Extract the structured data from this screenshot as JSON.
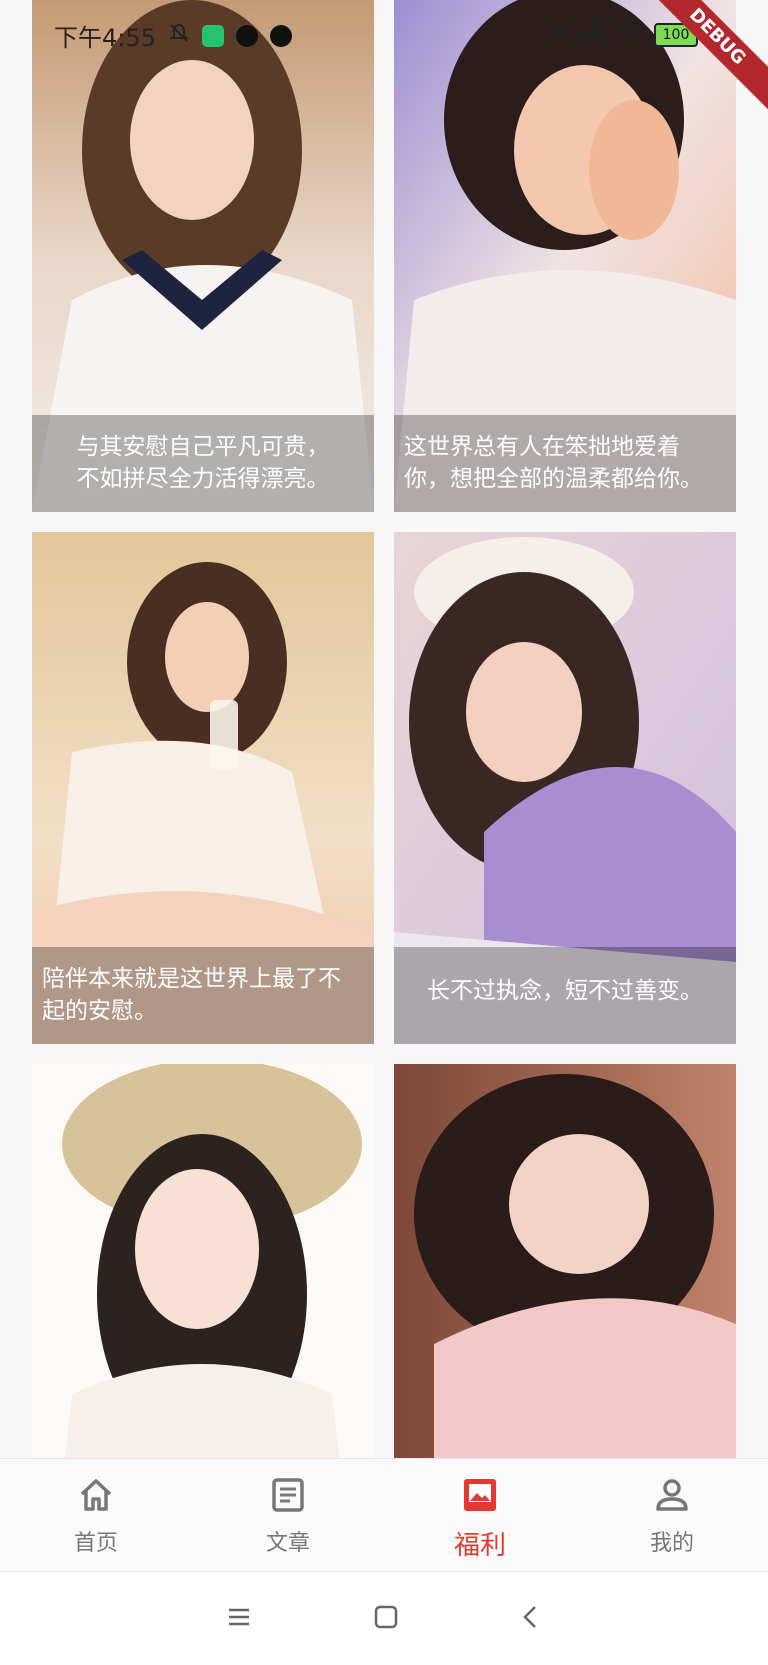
{
  "status_bar": {
    "time": "下午4:55",
    "battery": "100"
  },
  "debug_banner": "DEBUG",
  "cards": [
    {
      "caption": "与其安慰自己平凡可贵，\n不如拼尽全力活得漂亮。"
    },
    {
      "caption": "这世界总有人在笨拙地爱着\n你，想把全部的温柔都给你。"
    },
    {
      "caption": "陪伴本来就是这世界上最了不\n起的安慰。"
    },
    {
      "caption": "长不过执念，短不过善变。"
    },
    {
      "caption": ""
    },
    {
      "caption": ""
    }
  ],
  "bottom_nav": {
    "items": [
      {
        "label": "首页",
        "icon": "home-icon"
      },
      {
        "label": "文章",
        "icon": "article-icon"
      },
      {
        "label": "福利",
        "icon": "image-icon"
      },
      {
        "label": "我的",
        "icon": "person-icon"
      }
    ],
    "active_index": 2,
    "active_color": "#e23a30",
    "inactive_color": "#777777"
  },
  "system_nav": [
    "menu-icon",
    "home-square-icon",
    "back-icon"
  ]
}
